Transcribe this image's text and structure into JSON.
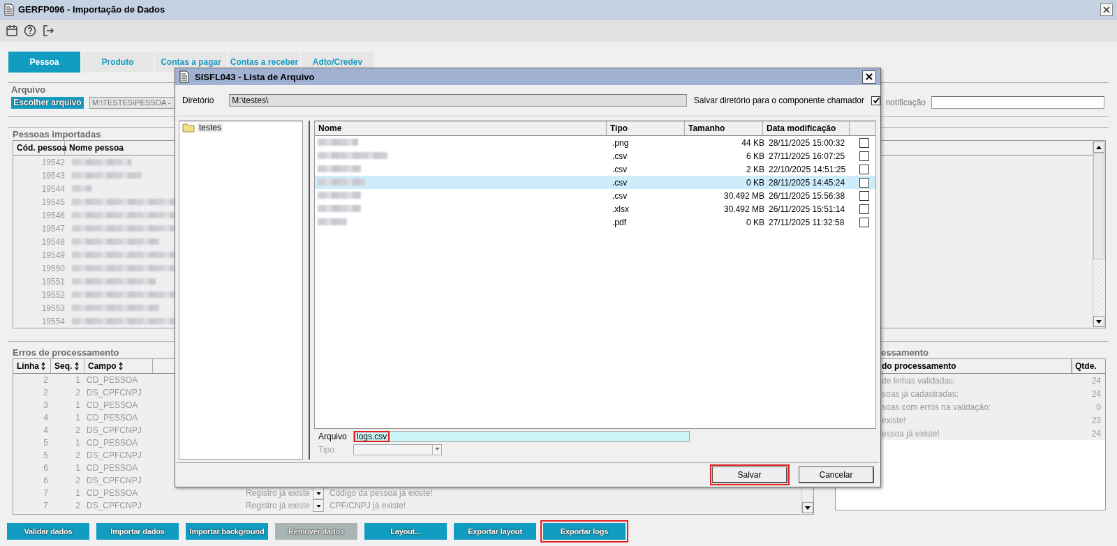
{
  "window": {
    "title": "GERFP096 - Importação de Dados"
  },
  "tabs": [
    {
      "label": "Pessoa",
      "selected": true
    },
    {
      "label": "Produto",
      "selected": false
    },
    {
      "label": "Contas a pagar",
      "selected": false
    },
    {
      "label": "Contas a receber",
      "selected": false
    },
    {
      "label": "Adto/Credev",
      "selected": false
    }
  ],
  "arquivo": {
    "title": "Arquivo",
    "button": "Escolher arquivo",
    "path": "M:\\TESTES\\PESSOA -",
    "notification_label": "notificação"
  },
  "pessoas": {
    "title": "Pessoas importadas",
    "columns": [
      "Cód. pessoa",
      "Nome pessoa"
    ],
    "rows": [
      {
        "code": "19542",
        "name_blurred": true
      },
      {
        "code": "19543",
        "name_blurred": true
      },
      {
        "code": "19544",
        "name_blurred": true
      },
      {
        "code": "19545",
        "name_blurred": true
      },
      {
        "code": "19546",
        "name_blurred": true
      },
      {
        "code": "19547",
        "name_blurred": true
      },
      {
        "code": "19548",
        "name_blurred": true
      },
      {
        "code": "19549",
        "name_blurred": true
      },
      {
        "code": "19550",
        "name_blurred": true
      },
      {
        "code": "19551",
        "name_blurred": true
      },
      {
        "code": "19552",
        "name_blurred": true
      },
      {
        "code": "19553",
        "name_blurred": true
      },
      {
        "code": "19554",
        "name_blurred": true
      }
    ]
  },
  "erros": {
    "title": "Erros de processamento",
    "columns": [
      "Linha",
      "Seq.",
      "Campo"
    ],
    "rows": [
      {
        "linha": "2",
        "seq": "1",
        "campo": "CD_PESSOA"
      },
      {
        "linha": "2",
        "seq": "2",
        "campo": "DS_CPFCNPJ"
      },
      {
        "linha": "3",
        "seq": "1",
        "campo": "CD_PESSOA"
      },
      {
        "linha": "4",
        "seq": "1",
        "campo": "CD_PESSOA"
      },
      {
        "linha": "4",
        "seq": "2",
        "campo": "DS_CPFCNPJ"
      },
      {
        "linha": "5",
        "seq": "1",
        "campo": "CD_PESSOA"
      },
      {
        "linha": "5",
        "seq": "2",
        "campo": "DS_CPFCNPJ"
      },
      {
        "linha": "6",
        "seq": "1",
        "campo": "CD_PESSOA"
      },
      {
        "linha": "6",
        "seq": "2",
        "campo": "DS_CPFCNPJ"
      },
      {
        "linha": "7",
        "seq": "1",
        "campo": "CD_PESSOA",
        "status": "Registro já existe",
        "mensagem": "Código da pessoa já existe!"
      },
      {
        "linha": "7",
        "seq": "2",
        "campo": "DS_CPFCNPJ",
        "status": "Registro já existe",
        "mensagem": "CPF/CNPJ já existe!"
      }
    ]
  },
  "resumo": {
    "title": "essamento",
    "columns": [
      "do processamento",
      "Qtde."
    ],
    "rows": [
      {
        "label": "de linhas validadas:",
        "value": "24"
      },
      {
        "label": "soas já cadastradas:",
        "value": "24"
      },
      {
        "label": "soas com erros na validação:",
        "value": "0"
      },
      {
        "label": "existe!",
        "value": "23"
      },
      {
        "label": "essoa já existe!",
        "value": "24"
      }
    ]
  },
  "buttons": [
    {
      "label": "Validar dados",
      "disabled": false,
      "highlighted": false
    },
    {
      "label": "Importar dados",
      "disabled": false,
      "highlighted": false
    },
    {
      "label": "Importar background",
      "disabled": false,
      "highlighted": false
    },
    {
      "label": "Remover dados",
      "disabled": true,
      "highlighted": false
    },
    {
      "label": "Layout...",
      "disabled": false,
      "highlighted": false
    },
    {
      "label": "Exportar layout",
      "disabled": false,
      "highlighted": false
    },
    {
      "label": "Exportar logs",
      "disabled": false,
      "highlighted": true
    }
  ],
  "dialog": {
    "title": "SISFL043 - Lista de Arquivo",
    "directory_label": "Diretório",
    "directory": "M:\\testes\\",
    "save_dir_label": "Salvar diretório para o componente chamador",
    "save_dir_checked": true,
    "tree": [
      {
        "label": "testes",
        "selected": true
      }
    ],
    "columns": [
      "Nome",
      "Tipo",
      "Tamanho",
      "Data modificação"
    ],
    "files": [
      {
        "name_blurred": true,
        "type": ".png",
        "size": "44 KB",
        "modified": "28/11/2025 15:00:32",
        "checked": false,
        "selected": false
      },
      {
        "name_blurred": true,
        "type": ".csv",
        "size": "6 KB",
        "modified": "27/11/2025 16:07:25",
        "checked": false,
        "selected": false
      },
      {
        "name_blurred": true,
        "type": ".csv",
        "size": "2 KB",
        "modified": "22/10/2025 14:51:25",
        "checked": false,
        "selected": false
      },
      {
        "name_blurred": true,
        "type": ".csv",
        "size": "0 KB",
        "modified": "28/11/2025 14:45:24",
        "checked": false,
        "selected": true
      },
      {
        "name_blurred": true,
        "type": ".csv",
        "size": "30.492 MB",
        "modified": "26/11/2025 15:56:38",
        "checked": false,
        "selected": false
      },
      {
        "name_blurred": true,
        "type": ".xlsx",
        "size": "30.492 MB",
        "modified": "26/11/2025 15:51:14",
        "checked": false,
        "selected": false
      },
      {
        "name_blurred": true,
        "type": ".pdf",
        "size": "0 KB",
        "modified": "27/11/2025 11:32:58",
        "checked": false,
        "selected": false
      }
    ],
    "file_label": "Arquivo",
    "file_value": "logs.csv",
    "file_highlighted": true,
    "type_label": "Tipo",
    "type_disabled": true,
    "buttons": [
      {
        "label": "Salvar",
        "highlighted": true
      },
      {
        "label": "Cancelar",
        "highlighted": false
      }
    ]
  }
}
